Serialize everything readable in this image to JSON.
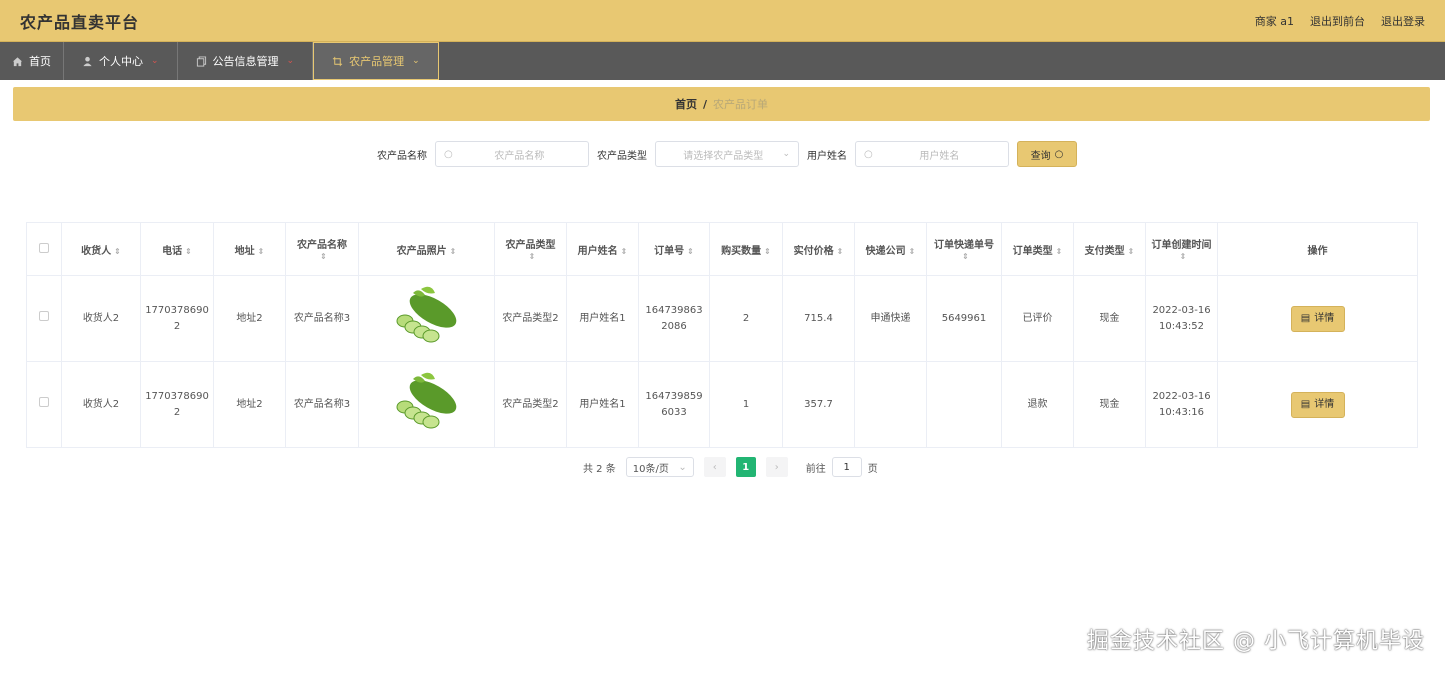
{
  "header": {
    "title": "农产品直卖平台",
    "user": "商家 a1",
    "goto_front": "退出到前台",
    "logout": "退出登录"
  },
  "nav": [
    {
      "label": "首页",
      "icon": "home-icon",
      "caret": false,
      "active": false
    },
    {
      "label": "个人中心",
      "icon": "user-icon",
      "caret": true,
      "active": false
    },
    {
      "label": "公告信息管理",
      "icon": "copy-icon",
      "caret": true,
      "active": false
    },
    {
      "label": "农产品管理",
      "icon": "crop-icon",
      "caret": true,
      "active": true
    }
  ],
  "breadcrumb": {
    "home": "首页",
    "sep": "/",
    "current": "农产品订单"
  },
  "search": {
    "name_label": "农产品名称",
    "name_placeholder": "农产品名称",
    "type_label": "农产品类型",
    "type_placeholder": "请选择农产品类型",
    "user_label": "用户姓名",
    "user_placeholder": "用户姓名",
    "query_label": "查询"
  },
  "table": {
    "columns": [
      "收货人",
      "电话",
      "地址",
      "农产品名称",
      "农产品照片",
      "农产品类型",
      "用户姓名",
      "订单号",
      "购买数量",
      "实付价格",
      "快递公司",
      "订单快递单号",
      "订单类型",
      "支付类型",
      "订单创建时间",
      "操作"
    ],
    "rows": [
      {
        "receiver": "收货人2",
        "phone": "17703786902",
        "address": "地址2",
        "name": "农产品名称3",
        "photo": "cucumber-image",
        "type": "农产品类型2",
        "user": "用户姓名1",
        "order_no": "1647398632086",
        "qty": "2",
        "price": "715.4",
        "courier": "申通快递",
        "tracking": "5649961",
        "order_type": "已评价",
        "pay_type": "现金",
        "created_date": "2022-03-16",
        "created_time": "10:43:52",
        "action": "详情"
      },
      {
        "receiver": "收货人2",
        "phone": "17703786902",
        "address": "地址2",
        "name": "农产品名称3",
        "photo": "cucumber-image",
        "type": "农产品类型2",
        "user": "用户姓名1",
        "order_no": "1647398596033",
        "qty": "1",
        "price": "357.7",
        "courier": "",
        "tracking": "",
        "order_type": "退款",
        "pay_type": "现金",
        "created_date": "2022-03-16",
        "created_time": "10:43:16",
        "action": "详情"
      }
    ]
  },
  "pagination": {
    "total": "共 2 条",
    "page_size": "10条/页",
    "current_page": "1",
    "goto_label": "前往",
    "goto_value": "1",
    "page_unit": "页"
  },
  "watermark": "掘金技术社区 @ 小飞计算机毕设",
  "colors": {
    "accent": "#e8c872",
    "nav_bg": "#595959",
    "page_active": "#22b573"
  }
}
